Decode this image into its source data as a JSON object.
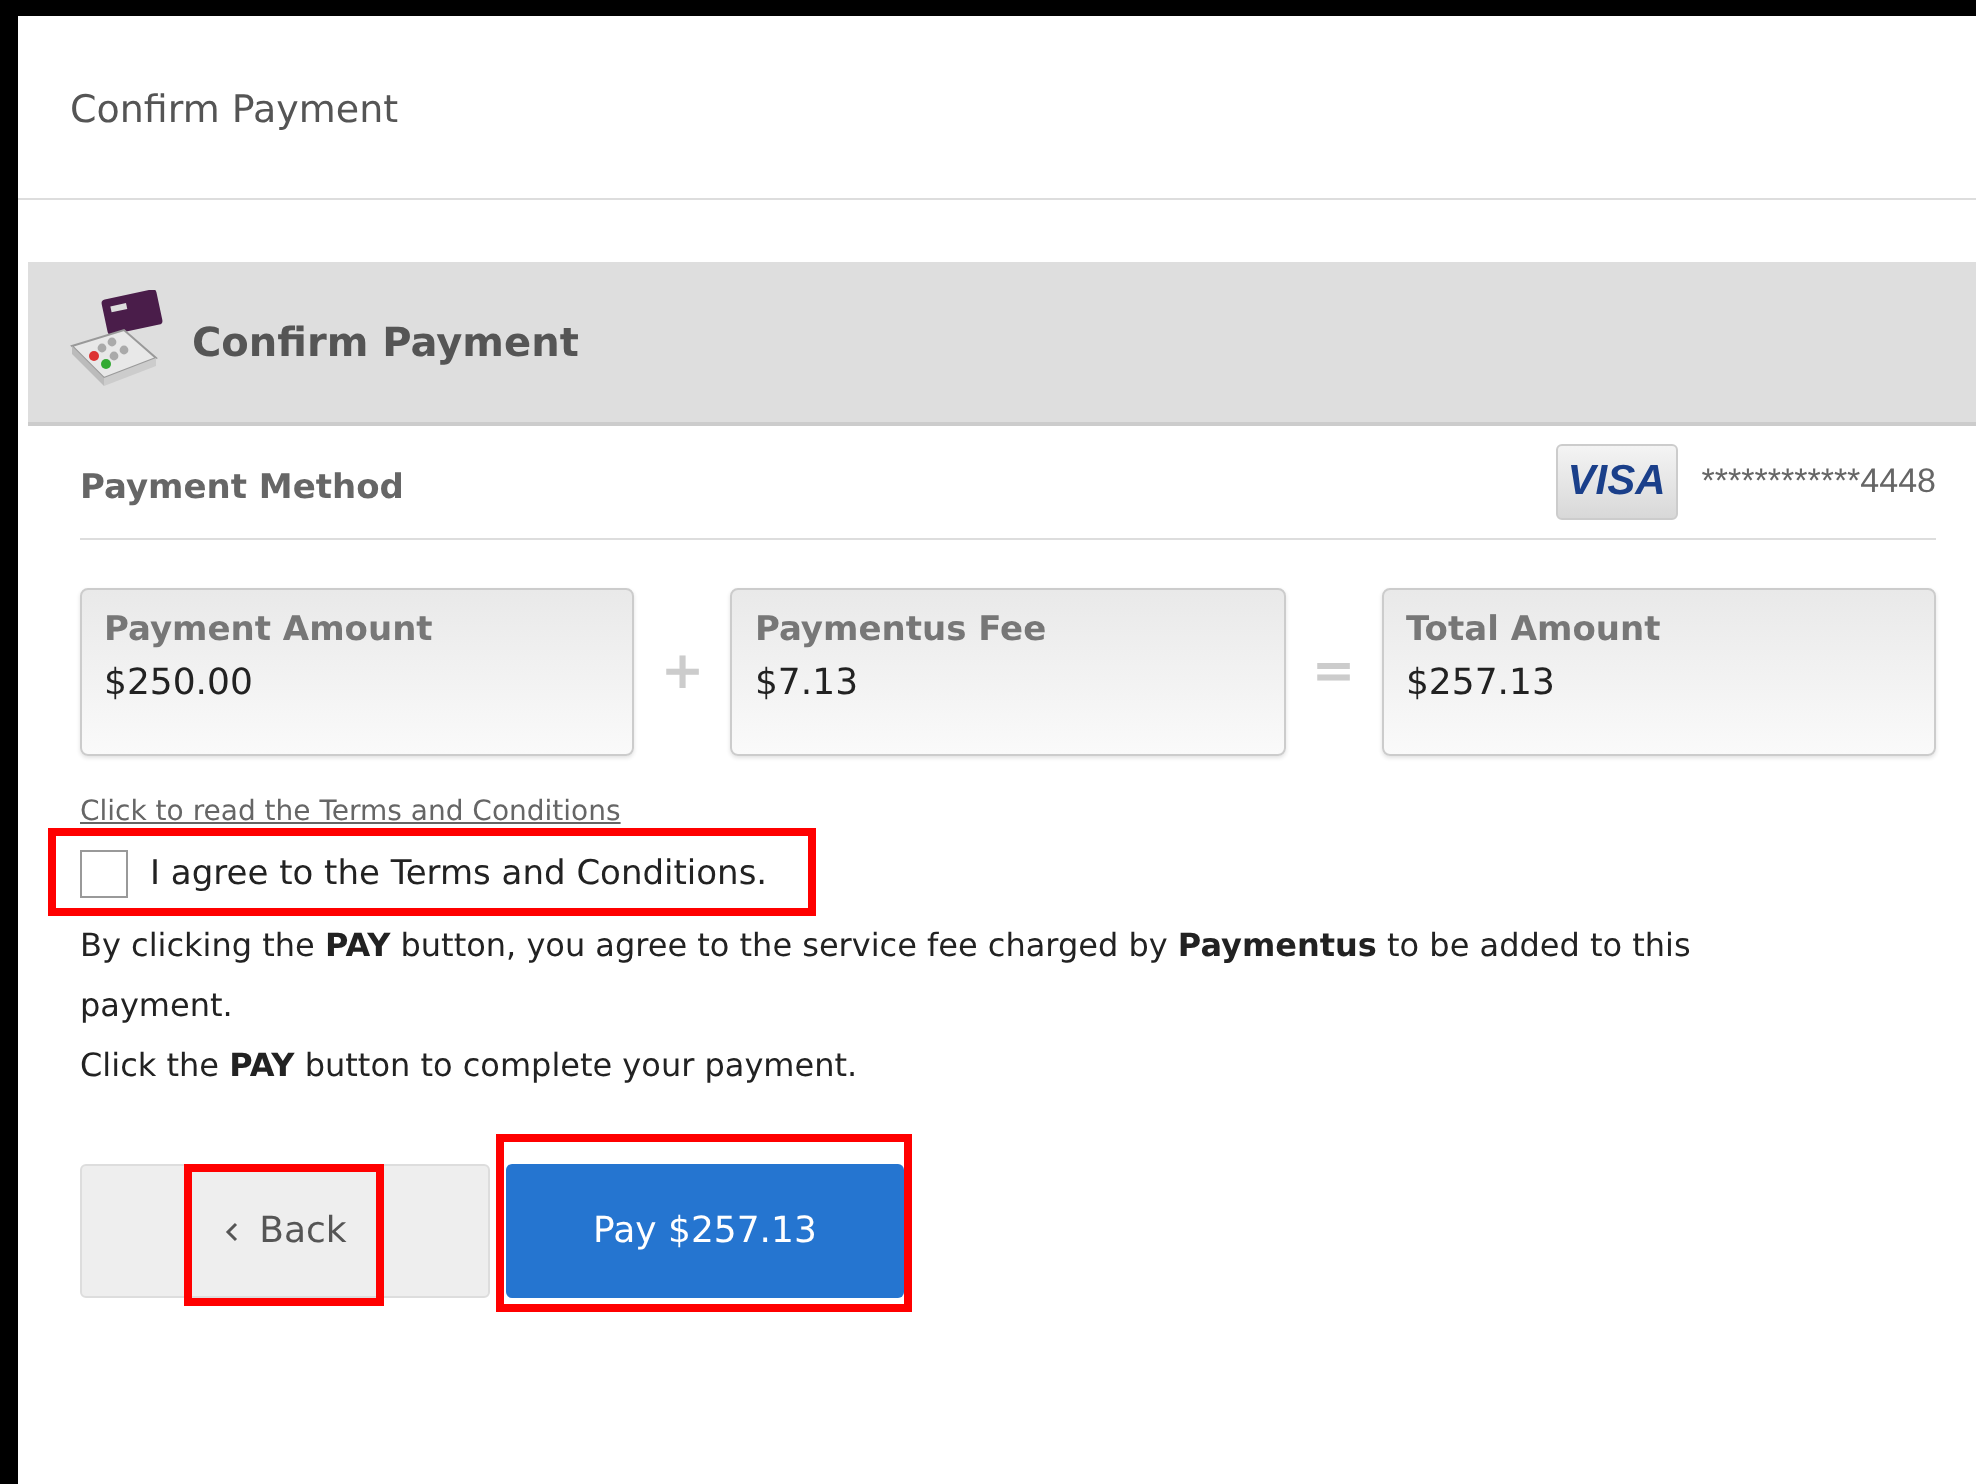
{
  "page_title": "Confirm Payment",
  "panel": {
    "title": "Confirm Payment"
  },
  "payment_method": {
    "label": "Payment Method",
    "card_brand": "VISA",
    "card_number": "************4448"
  },
  "amounts": [
    {
      "kind": "value",
      "label": "Payment Amount",
      "value": "$250.00"
    },
    {
      "kind": "operator",
      "symbol": "+"
    },
    {
      "kind": "value",
      "label": "Paymentus Fee",
      "value": "$7.13"
    },
    {
      "kind": "operator",
      "symbol": "="
    },
    {
      "kind": "value",
      "label": "Total Amount",
      "value": "$257.13"
    }
  ],
  "terms_link": "Click to read the Terms and Conditions",
  "agree": {
    "label": "I agree to the Terms and Conditions.",
    "checked": false,
    "highlighted": true
  },
  "notes": [
    "By clicking the **PAY** button, you agree to the service fee charged by **Paymentus** to be added to this payment.",
    "Click the **PAY** button to complete your payment."
  ],
  "buttons": [
    {
      "kind": "back",
      "label": "Back",
      "highlighted": true
    },
    {
      "kind": "pay",
      "label": "Pay $257.13",
      "highlighted": true
    }
  ]
}
